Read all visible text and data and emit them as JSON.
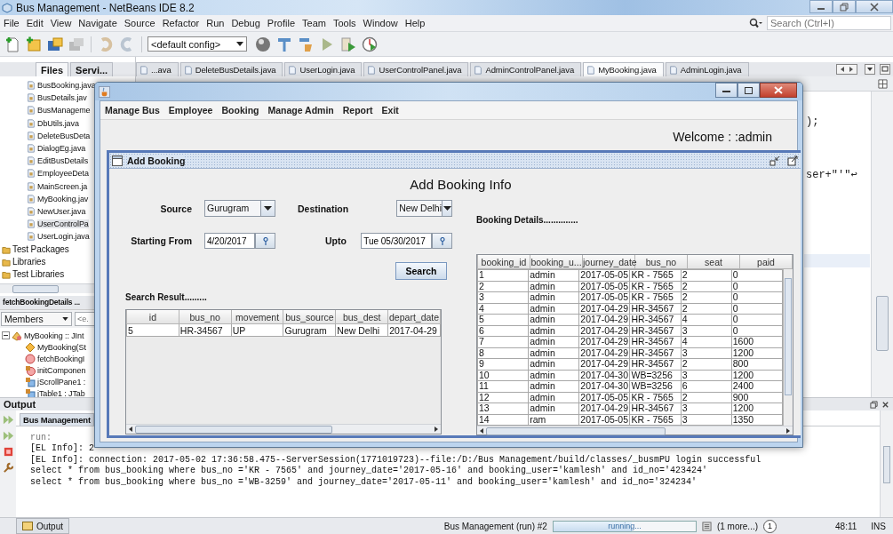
{
  "window": {
    "title": "Bus Management - NetBeans IDE 8.2"
  },
  "menu": [
    "File",
    "Edit",
    "View",
    "Navigate",
    "Source",
    "Refactor",
    "Run",
    "Debug",
    "Profile",
    "Team",
    "Tools",
    "Window",
    "Help"
  ],
  "search": {
    "placeholder": "Search (Ctrl+I)"
  },
  "toolbar": {
    "config": "<default config>"
  },
  "project_tabs": [
    {
      "label": "Files",
      "selected": true
    },
    {
      "label": "Servi...",
      "selected": false
    }
  ],
  "project_tree": [
    {
      "label": "BusBooking.java",
      "selected": false
    },
    {
      "label": "BusDetails.jav",
      "selected": false
    },
    {
      "label": "BusManageme",
      "selected": false
    },
    {
      "label": "DbUtils.java",
      "selected": false
    },
    {
      "label": "DeleteBusDeta",
      "selected": false
    },
    {
      "label": "DialogEg.java",
      "selected": false
    },
    {
      "label": "EditBusDetails",
      "selected": false
    },
    {
      "label": "EmployeeDeta",
      "selected": false
    },
    {
      "label": "MainScreen.ja",
      "selected": false
    },
    {
      "label": "MyBooking.jav",
      "selected": false
    },
    {
      "label": "NewUser.java",
      "selected": false
    },
    {
      "label": "UserControlPa",
      "selected": true
    },
    {
      "label": "UserLogin.java",
      "selected": false
    }
  ],
  "project_nodes": [
    "Test Packages",
    "Libraries",
    "Test Libraries"
  ],
  "navigator": {
    "title": "fetchBookingDetails ...",
    "filter": "Members",
    "placeholder": "<e.",
    "members": [
      {
        "label": "MyBooking :: JInt",
        "kind": "class",
        "expanded": true,
        "children": [
          {
            "label": "MyBooking(St",
            "kind": "constructor"
          },
          {
            "label": "fetchBookingI",
            "kind": "method"
          },
          {
            "label": "initComponen",
            "kind": "private-method"
          },
          {
            "label": "jScrollPane1 :",
            "kind": "field"
          },
          {
            "label": "jTable1 : JTab",
            "kind": "field"
          }
        ]
      }
    ]
  },
  "editor_tabs": [
    {
      "label": "...ava",
      "selected": false
    },
    {
      "label": "DeleteBusDetails.java",
      "selected": false
    },
    {
      "label": "UserLogin.java",
      "selected": false
    },
    {
      "label": "UserControlPanel.java",
      "selected": false
    },
    {
      "label": "AdminControlPanel.java",
      "selected": false
    },
    {
      "label": "MyBooking.java",
      "selected": true
    },
    {
      "label": "AdminLogin.java",
      "selected": false
    }
  ],
  "code_fragments": [
    ");",
    "ser+\"'\"↩"
  ],
  "output": {
    "title": "Output",
    "tab": "Bus Management",
    "lines": [
      "run:",
      "[EL Info]: 2",
      "[EL Info]: connection: 2017-05-02 17:36:58.475--ServerSession(1771019723)--file:/D:/Bus Management/build/classes/_busmPU login successful",
      "select * from bus_booking where bus_no ='KR - 7565' and journey_date='2017-05-16' and booking_user='kamlesh' and id_no='423424'",
      "select * from bus_booking where bus_no ='WB-3259' and journey_date='2017-05-11' and booking_user='kamlesh' and id_no='324234'"
    ]
  },
  "status_bar": {
    "output_tab": "Output",
    "task": "Bus Management (run) #2",
    "progress": {
      "text": "running...",
      "level": 0.55
    },
    "more": "(1 more...)",
    "notifications": "1",
    "position": "48:11",
    "mode": "INS"
  },
  "dialog": {
    "menu": [
      "Manage Bus",
      "Employee",
      "Booking",
      "Manage Admin",
      "Report",
      "Exit"
    ],
    "welcome": "Welcome : :admin",
    "frame": {
      "title": "Add Booking",
      "heading": "Add Booking Info",
      "source": {
        "label": "Source",
        "value": "Gurugram"
      },
      "destination": {
        "label": "Destination",
        "value": "New Delhi"
      },
      "start": {
        "label": "Starting From",
        "value": "4/20/2017"
      },
      "upto": {
        "label": "Upto",
        "value": "Tue 05/30/2017"
      },
      "search_button": "Search",
      "result_title": "Search Result.........",
      "result_table": {
        "columns": [
          "id",
          "bus_no",
          "movement",
          "bus_source",
          "bus_dest",
          "depart_date"
        ],
        "rows": [
          [
            "5",
            "HR-34567",
            "UP",
            "Gurugram",
            "New Delhi",
            "2017-04-29"
          ]
        ]
      },
      "details_title": "Booking Details..............",
      "details_table": {
        "columns": [
          "booking_id",
          "booking_u...",
          "journey_date",
          "bus_no",
          "seat",
          "paid"
        ],
        "rows": [
          [
            "1",
            "admin",
            "2017-05-05",
            "KR - 7565",
            "2",
            "0"
          ],
          [
            "2",
            "admin",
            "2017-05-05",
            "KR - 7565",
            "2",
            "0"
          ],
          [
            "3",
            "admin",
            "2017-05-05",
            "KR - 7565",
            "2",
            "0"
          ],
          [
            "4",
            "admin",
            "2017-04-29",
            "HR-34567",
            "2",
            "0"
          ],
          [
            "5",
            "admin",
            "2017-04-29",
            "HR-34567",
            "4",
            "0"
          ],
          [
            "6",
            "admin",
            "2017-04-29",
            "HR-34567",
            "3",
            "0"
          ],
          [
            "7",
            "admin",
            "2017-04-29",
            "HR-34567",
            "4",
            "1600"
          ],
          [
            "8",
            "admin",
            "2017-04-29",
            "HR-34567",
            "3",
            "1200"
          ],
          [
            "9",
            "admin",
            "2017-04-29",
            "HR-34567",
            "2",
            "800"
          ],
          [
            "10",
            "admin",
            "2017-04-30",
            "WB=3256",
            "3",
            "1200"
          ],
          [
            "11",
            "admin",
            "2017-04-30",
            "WB=3256",
            "6",
            "2400"
          ],
          [
            "12",
            "admin",
            "2017-05-05",
            "KR - 7565",
            "2",
            "900"
          ],
          [
            "13",
            "admin",
            "2017-04-29",
            "HR-34567",
            "3",
            "1200"
          ],
          [
            "14",
            "ram",
            "2017-05-05",
            "KR - 7565",
            "3",
            "1350"
          ]
        ]
      }
    }
  }
}
